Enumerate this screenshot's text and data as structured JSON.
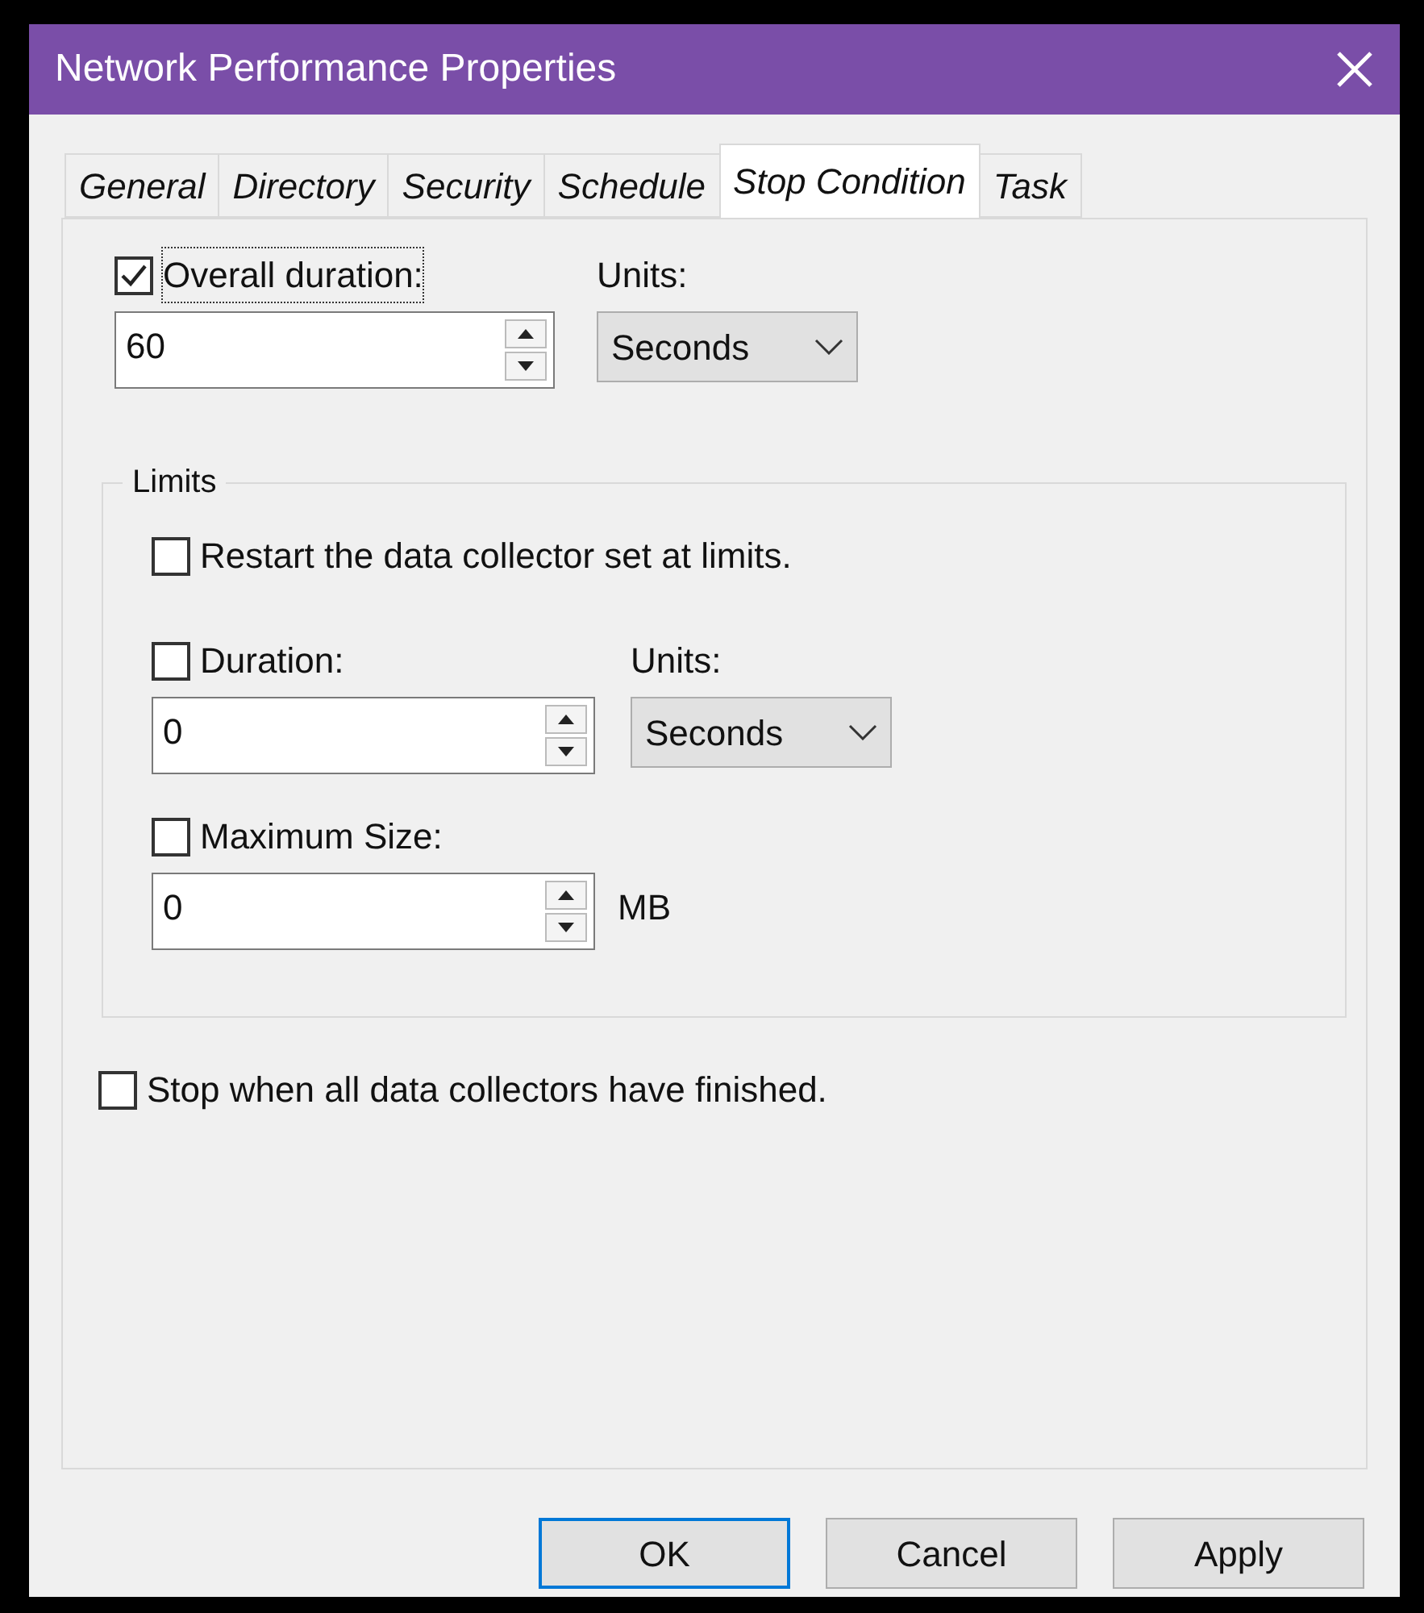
{
  "window": {
    "title": "Network Performance Properties"
  },
  "tabs": [
    {
      "label": "General",
      "selected": false
    },
    {
      "label": "Directory",
      "selected": false
    },
    {
      "label": "Security",
      "selected": false
    },
    {
      "label": "Schedule",
      "selected": false
    },
    {
      "label": "Stop Condition",
      "selected": true
    },
    {
      "label": "Task",
      "selected": false
    }
  ],
  "overall_duration": {
    "label": "Overall duration:",
    "checked": true,
    "value": "60",
    "units_label": "Units:",
    "units": "Seconds"
  },
  "limits": {
    "title": "Limits",
    "restart": {
      "label": "Restart the data collector set at limits.",
      "checked": false
    },
    "duration": {
      "label": "Duration:",
      "checked": false,
      "value": "0",
      "units_label": "Units:",
      "units": "Seconds"
    },
    "maximum_size": {
      "label": "Maximum Size:",
      "checked": false,
      "value": "0",
      "unit": "MB"
    }
  },
  "stop_when_finished": {
    "label": "Stop when all data collectors have finished.",
    "checked": false
  },
  "buttons": [
    {
      "label": "OK",
      "focused": true
    },
    {
      "label": "Cancel",
      "focused": false
    },
    {
      "label": "Apply",
      "focused": false
    }
  ]
}
